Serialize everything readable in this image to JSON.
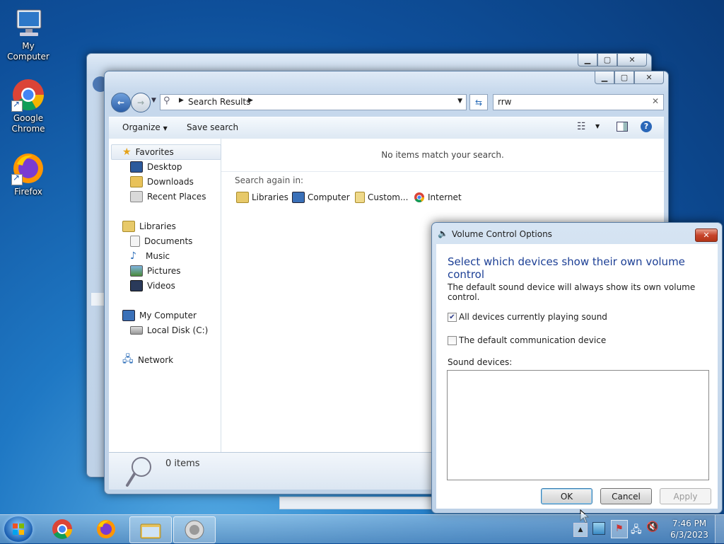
{
  "desktop": {
    "icons": [
      {
        "label": "My Computer"
      },
      {
        "label": "Google Chrome"
      },
      {
        "label": "Firefox"
      }
    ]
  },
  "explorer": {
    "address_root_icon": "search-icon",
    "address_path": "Search Results",
    "search_value": "rrw",
    "toolbar": {
      "organize": "Organize",
      "save_search": "Save search"
    },
    "nav": {
      "favorites": "Favorites",
      "desktop": "Desktop",
      "downloads": "Downloads",
      "recent": "Recent Places",
      "libraries": "Libraries",
      "documents": "Documents",
      "music": "Music",
      "pictures": "Pictures",
      "videos": "Videos",
      "my_computer": "My Computer",
      "local_disk": "Local Disk (C:)",
      "network": "Network"
    },
    "no_items": "No items match your search.",
    "search_again": "Search again in:",
    "search_again_items": [
      "Libraries",
      "Computer",
      "Custom...",
      "Internet"
    ],
    "status": "0 items"
  },
  "dialog": {
    "title": "Volume Control Options",
    "heading": "Select which devices show their own volume control",
    "description": "The default sound device will always show its own volume control.",
    "options": [
      {
        "label": "All devices currently playing sound",
        "checked": true
      },
      {
        "label": "The default communication device",
        "checked": false
      }
    ],
    "list_label": "Sound devices:",
    "buttons": {
      "ok": "OK",
      "cancel": "Cancel",
      "apply": "Apply"
    }
  },
  "taskbar": {
    "time": "7:46 PM",
    "date": "6/3/2023"
  },
  "colors": {
    "heading": "#1c3f95",
    "accent": "#1f78c4"
  }
}
